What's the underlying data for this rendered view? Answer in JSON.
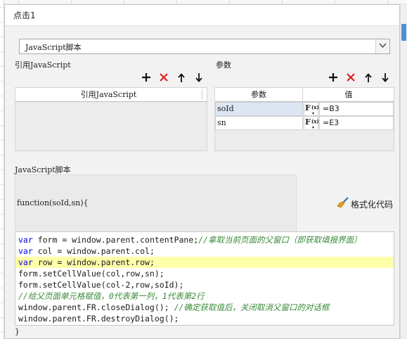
{
  "dialog": {
    "title": "点击1"
  },
  "script_type": {
    "selected": "JavaScript脚本"
  },
  "library_section": {
    "label": "引用JavaScript",
    "column_header": "引用JavaScript"
  },
  "params_section": {
    "label": "参数",
    "columns": [
      "参数",
      "值"
    ],
    "rows": [
      {
        "name": "soId",
        "value": "=B3"
      },
      {
        "name": "sn",
        "value": "=E3"
      }
    ],
    "formula_glyph": {
      "f": "F",
      "x": "(x)",
      "v": "▾"
    }
  },
  "toolbar_icons": [
    "add-icon",
    "delete-icon",
    "move-up-icon",
    "move-down-icon"
  ],
  "script_section": {
    "label": "JavaScript脚本",
    "signature": "function(soId,sn){",
    "closing": "}",
    "format_button": "格式化代码"
  },
  "code": {
    "lines": [
      {
        "tokens": [
          [
            "kw",
            "var"
          ],
          [
            "nm",
            " form = window.parent.contentPane;"
          ],
          [
            "cm",
            "//拿取当前页面的父窗口（即获取填报界面）"
          ]
        ]
      },
      {
        "tokens": [
          [
            "kw",
            "var"
          ],
          [
            "nm",
            " col = window.parent.col;"
          ]
        ]
      },
      {
        "tokens": [
          [
            "kw",
            "var"
          ],
          [
            "nm",
            " row = window.parent.row;"
          ]
        ],
        "highlight": true
      },
      {
        "tokens": [
          [
            "nm",
            "form.setCellValue(col,row,sn);"
          ]
        ]
      },
      {
        "tokens": [
          [
            "nm",
            "form.setCellValue(col-2,row,soId);"
          ]
        ]
      },
      {
        "tokens": [
          [
            "cm",
            "//给父页面单元格赋值，0代表第一列，1代表第2行"
          ]
        ]
      },
      {
        "tokens": [
          [
            "nm",
            "window.parent.FR.closeDialog(); "
          ],
          [
            "cm",
            "//确定获取值后，关闭取消父窗口的对话框"
          ]
        ]
      },
      {
        "tokens": [
          [
            "nm",
            "window.parent.FR.destroyDialog();"
          ]
        ]
      }
    ]
  },
  "colors": {
    "keyword": "#0000e6",
    "comment": "#3a8a3a",
    "highlight": "#ffffaa",
    "delete": "#e02020",
    "selected_row": "#dce6f2"
  }
}
